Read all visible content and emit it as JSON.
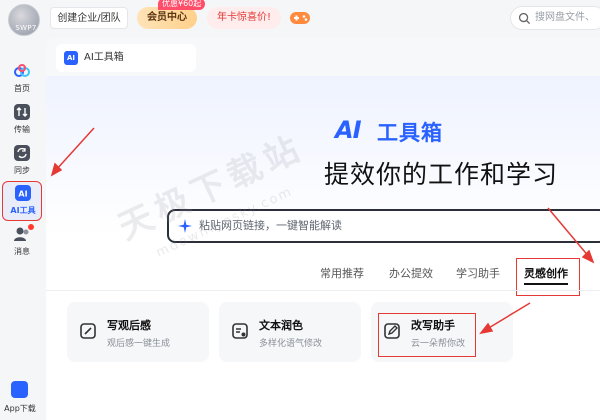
{
  "topbar": {
    "avatar_text": "SWP7",
    "team_button": "创建企业/团队",
    "member_button": "会员中心",
    "member_badge": "优惠¥60起",
    "yearcard_button": "年卡惊喜价!",
    "game_icon": "gamepad-icon",
    "search_placeholder": "搜网盘文件、"
  },
  "sidebar": {
    "items": [
      {
        "label": "首页",
        "icon": "home-cloud-icon"
      },
      {
        "label": "传输",
        "icon": "transfer-icon"
      },
      {
        "label": "同步",
        "icon": "sync-icon"
      },
      {
        "label": "AI工具",
        "icon": "ai-tool-icon",
        "active": true
      },
      {
        "label": "消息",
        "icon": "message-icon",
        "has_dot": true
      }
    ],
    "app_download": "App下载"
  },
  "tabs": [
    {
      "label": "AI工具箱"
    }
  ],
  "hero": {
    "logo_ai": "AI",
    "logo_text": "工具箱",
    "title": "提效你的工作和学习"
  },
  "input": {
    "placeholder": "粘贴网页链接，一键智能解读"
  },
  "categories": [
    {
      "label": "常用推荐"
    },
    {
      "label": "办公提效"
    },
    {
      "label": "学习助手"
    },
    {
      "label": "灵感创作",
      "active": true
    }
  ],
  "cards": [
    {
      "title": "写观后感",
      "subtitle": "观后感一键生成",
      "icon": "edit-note-icon"
    },
    {
      "title": "文本润色",
      "subtitle": "多样化语气修改",
      "icon": "polish-text-icon"
    },
    {
      "title": "改写助手",
      "subtitle": "云一朵帮你改",
      "icon": "rewrite-pen-icon"
    }
  ],
  "watermark": {
    "main": "天极下载站",
    "sub": "mdown.yesky.com"
  },
  "colors": {
    "accent": "#2a62ff",
    "annotation": "#e53935",
    "background": "#f5f6f8"
  }
}
